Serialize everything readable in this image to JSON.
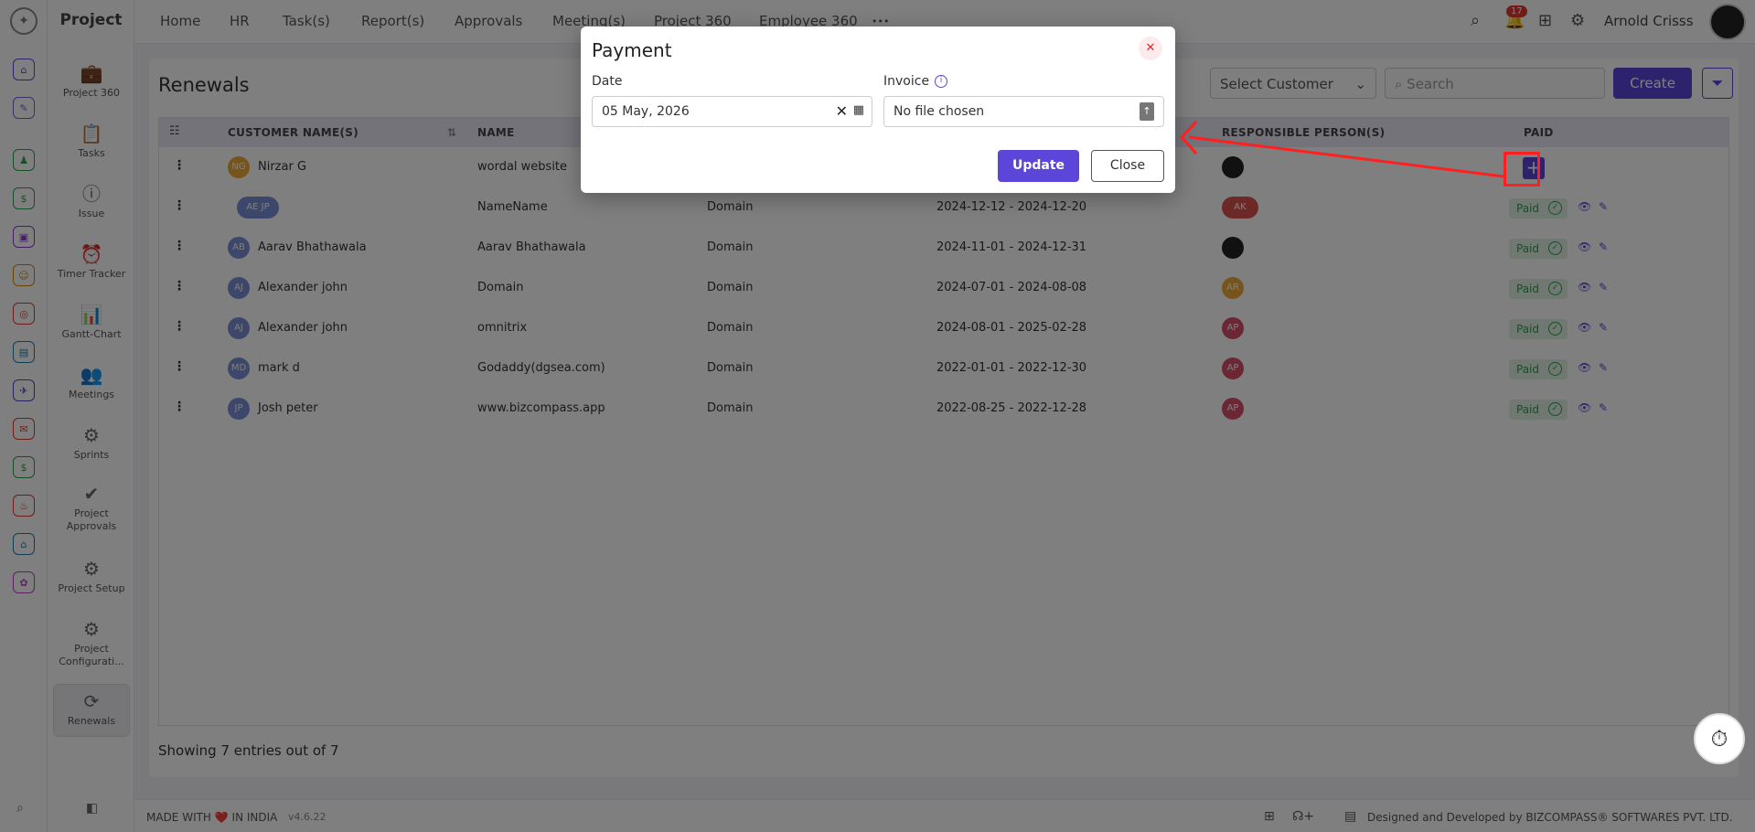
{
  "app": {
    "title": "Project"
  },
  "sidebar": {
    "items": [
      {
        "label": "Project 360",
        "icon": "briefcase-icon",
        "glyph": "💼"
      },
      {
        "label": "Tasks",
        "icon": "clipboard-icon",
        "glyph": "📋"
      },
      {
        "label": "Issue",
        "icon": "alert-icon",
        "glyph": "ⓘ"
      },
      {
        "label": "Timer Tracker",
        "icon": "alarm-icon",
        "glyph": "⏰"
      },
      {
        "label": "Gantt-Chart",
        "icon": "gantt-icon",
        "glyph": "📊"
      },
      {
        "label": "Meetings",
        "icon": "meetings-icon",
        "glyph": "👥"
      },
      {
        "label": "Sprints",
        "icon": "gear-icon",
        "glyph": "⚙"
      },
      {
        "label": "Project Approvals",
        "icon": "approval-icon",
        "glyph": "✔"
      },
      {
        "label": "Project Setup",
        "icon": "gear-icon",
        "glyph": "⚙"
      },
      {
        "label": "Project Configurati...",
        "icon": "gear-icon",
        "glyph": "⚙"
      },
      {
        "label": "Renewals",
        "icon": "refresh-icon",
        "glyph": "⟳"
      }
    ]
  },
  "topnav": {
    "items": [
      "Home",
      "HR",
      "Task(s)",
      "Report(s)",
      "Approvals",
      "Meeting(s)",
      "Project 360",
      "Employee 360"
    ],
    "more": "•••",
    "notif_count": "17",
    "user_name": "Arnold Crisss"
  },
  "page": {
    "title": "Renewals",
    "select_customer": "Select Customer",
    "search_placeholder": "Search",
    "create_label": "Create",
    "showing": "Showing 7 entries out of 7"
  },
  "table": {
    "headers": {
      "customer": "CUSTOMER NAME(S)",
      "name": "NAME",
      "responsible": "RESPONSIBLE PERSON(S)",
      "paid": "PAID"
    },
    "rows": [
      {
        "customer": "Nirzar G",
        "cust_initials": "NG",
        "name": "wordal website",
        "type": "",
        "dates": "",
        "resp": "",
        "paid": ""
      },
      {
        "customer": "",
        "cust_initials": "AE JP",
        "name": "NameName",
        "type": "Domain",
        "dates": "2024-12-12 - 2024-12-20",
        "resp": "AK",
        "paid": "Paid"
      },
      {
        "customer": "Aarav Bhathawala",
        "cust_initials": "AB",
        "name": "Aarav Bhathawala",
        "type": "Domain",
        "dates": "2024-11-01 - 2024-12-31",
        "resp": "",
        "paid": "Paid"
      },
      {
        "customer": "Alexander john",
        "cust_initials": "AJ",
        "name": "Domain",
        "type": "Domain",
        "dates": "2024-07-01 - 2024-08-08",
        "resp": "AR",
        "paid": "Paid"
      },
      {
        "customer": "Alexander john",
        "cust_initials": "AJ",
        "name": "omnitrix",
        "type": "Domain",
        "dates": "2024-08-01 - 2025-02-28",
        "resp": "AP",
        "paid": "Paid"
      },
      {
        "customer": "mark d",
        "cust_initials": "MD",
        "name": "Godaddy(dgsea.com)",
        "type": "Domain",
        "dates": "2022-01-01 - 2022-12-30",
        "resp": "AP",
        "paid": "Paid"
      },
      {
        "customer": "Josh peter",
        "cust_initials": "JP",
        "name": "www.bizcompass.app",
        "type": "Domain",
        "dates": "2022-08-25 - 2022-12-28",
        "resp": "AP",
        "paid": "Paid"
      }
    ]
  },
  "modal": {
    "title": "Payment",
    "date_label": "Date",
    "date_value": "05 May, 2026",
    "invoice_label": "Invoice",
    "invoice_value": "No file chosen",
    "update_label": "Update",
    "close_label": "Close"
  },
  "footer": {
    "made_with": "MADE WITH ❤️ IN INDIA",
    "version": "v4.6.22",
    "credit": "Designed and Developed by  BIZCOMPASS® SOFTWARES PVT. LTD."
  },
  "colors": {
    "accent": "#5b46d9",
    "highlight": "#ff1f1f"
  }
}
